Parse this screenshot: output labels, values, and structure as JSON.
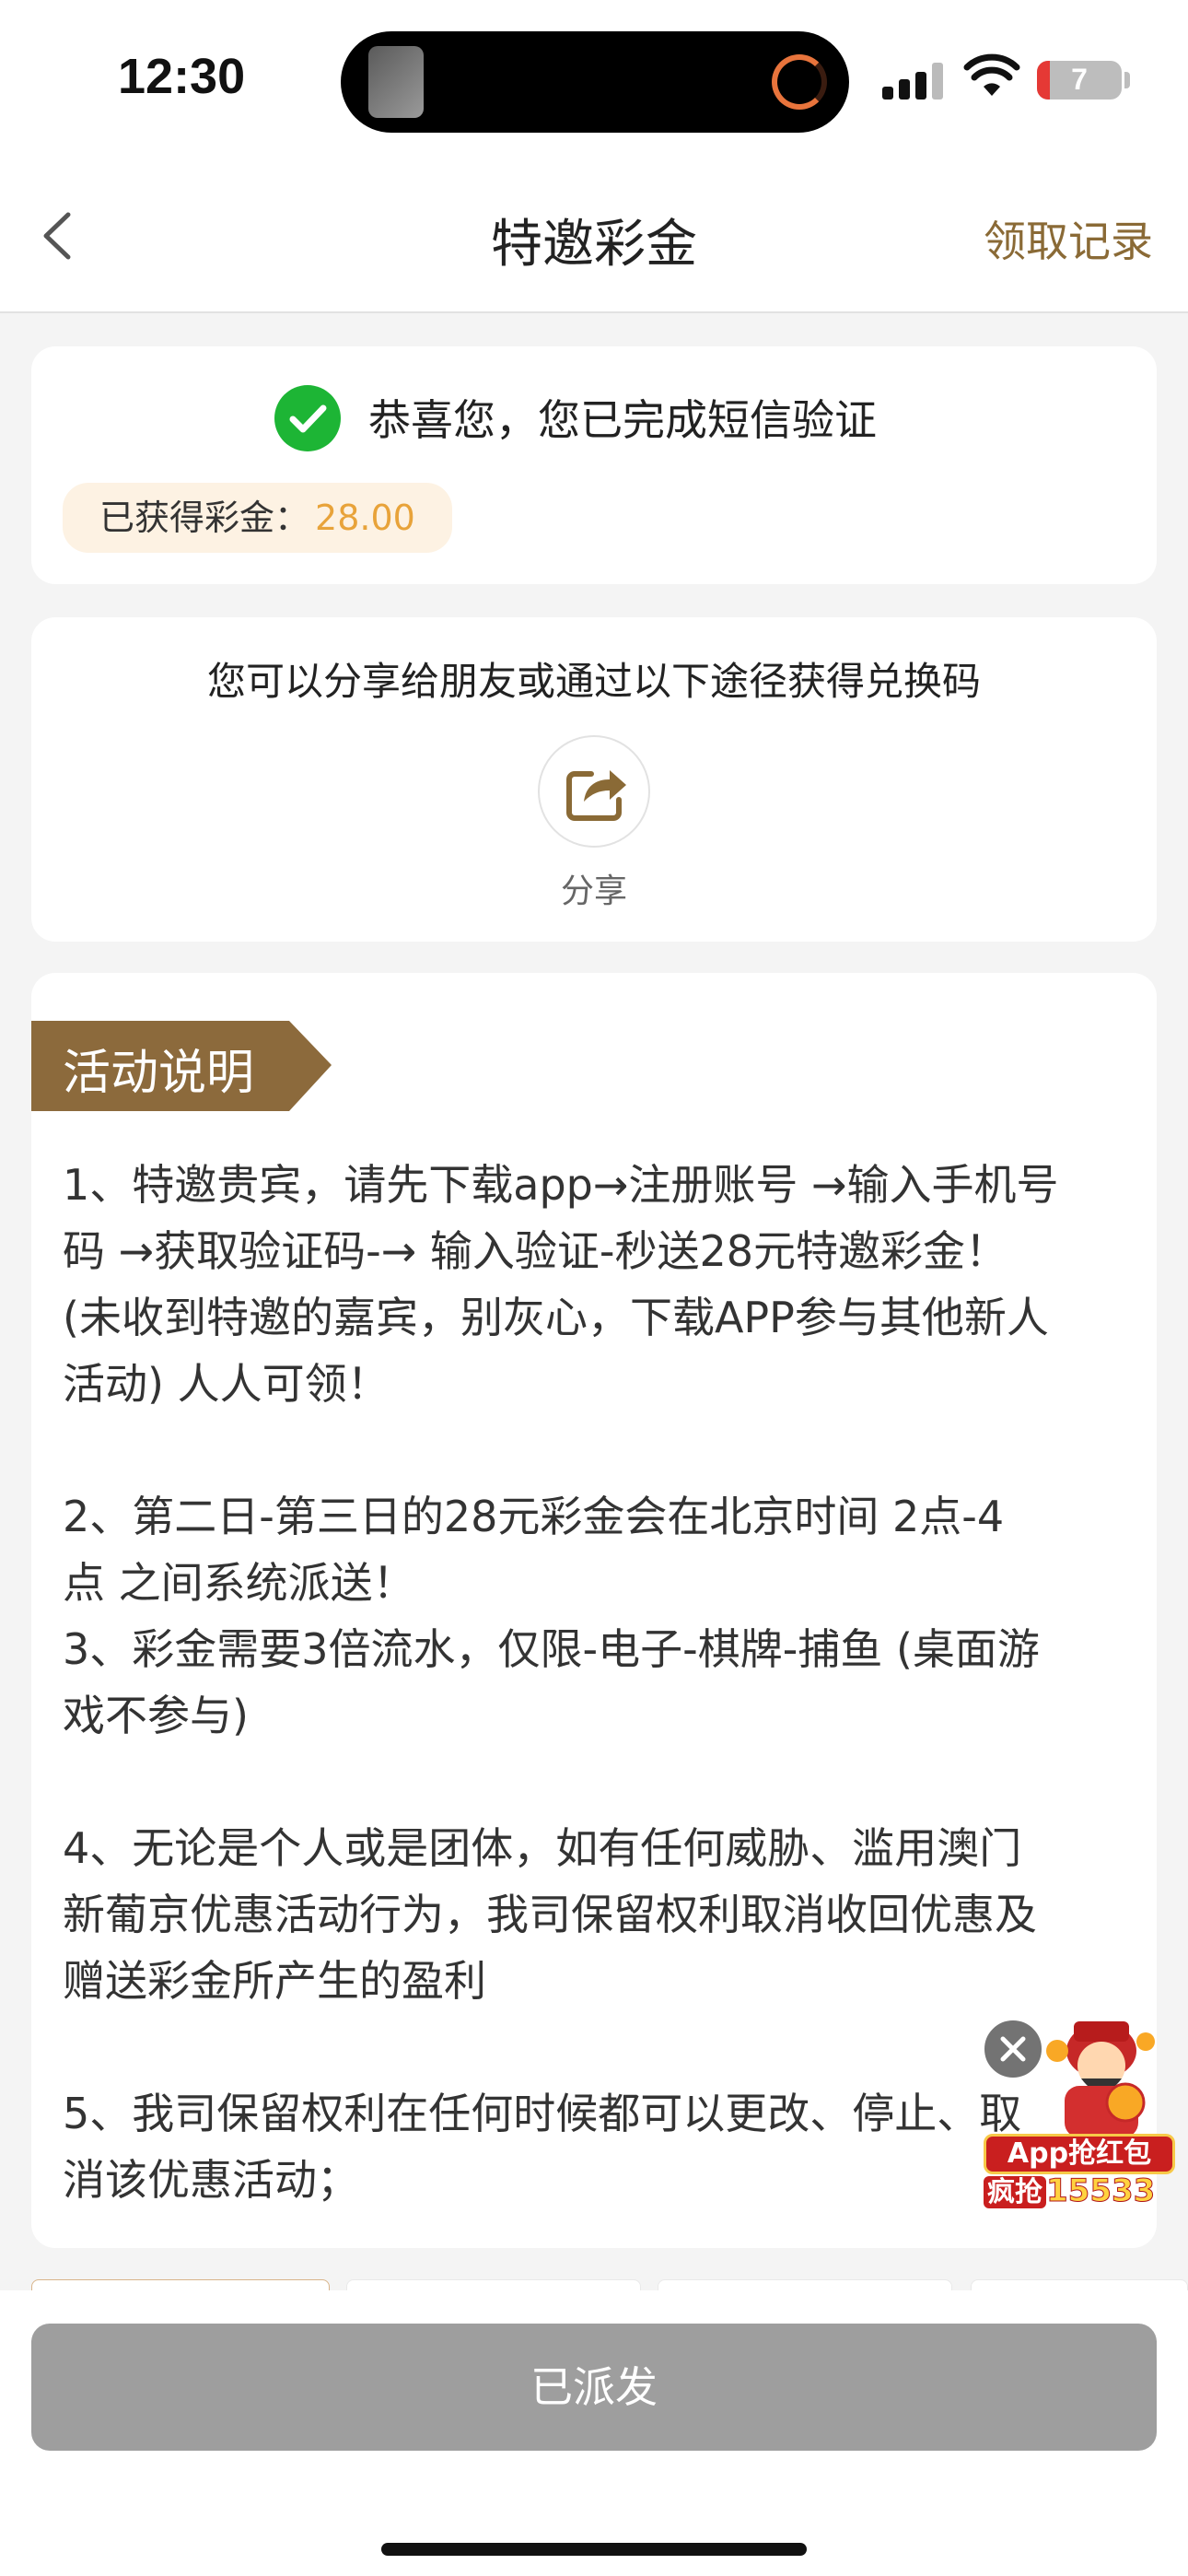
{
  "status_bar": {
    "time": "12:30",
    "battery": "7"
  },
  "nav": {
    "title": "特邀彩金",
    "record_link": "领取记录"
  },
  "success": {
    "message": "恭喜您，您已完成短信验证",
    "earned_label": "已获得彩金：",
    "earned_value": "28.00"
  },
  "share": {
    "intro": "您可以分享给朋友或通过以下途径获得兑换码",
    "label": "分享"
  },
  "activity": {
    "title": "活动说明",
    "rules": "1、特邀贵宾，请先下载app→注册账号 →输入手机号\n码 →获取验证码-→ 输入验证-秒送28元特邀彩金！\n(未收到特邀的嘉宾，别灰心，下载APP参与其他新人\n活动) 人人可领！\n\n2、第二日-第三日的28元彩金会在北京时间 2点-4\n点 之间系统派送！\n3、彩金需要3倍流水，仅限-电子-棋牌-捕鱼 (桌面游\n戏不参与)\n\n4、无论是个人或是团体，如有任何威胁、滥用澳门\n新葡京优惠活动行为，我司保留权利取消收回优惠及\n赠送彩金所产生的盈利\n\n5、我司保留权利在任何时候都可以更改、停止、取\n消该优惠活动；"
  },
  "promo": {
    "line1": "App抢红包",
    "line2_prefix": "疯抢",
    "line2_number": "15533"
  },
  "bottom": {
    "button_label": "已派发"
  },
  "colors": {
    "accent_brown": "#8a6a36",
    "tag_brown": "#8c6a3c",
    "gold": "#e8a33a",
    "success_green": "#1db535",
    "disabled_gray": "#9e9e9e"
  },
  "icons": [
    "back-arrow-icon",
    "check-circle-icon",
    "share-icon",
    "close-icon",
    "signal-icon",
    "wifi-icon",
    "battery-icon"
  ]
}
